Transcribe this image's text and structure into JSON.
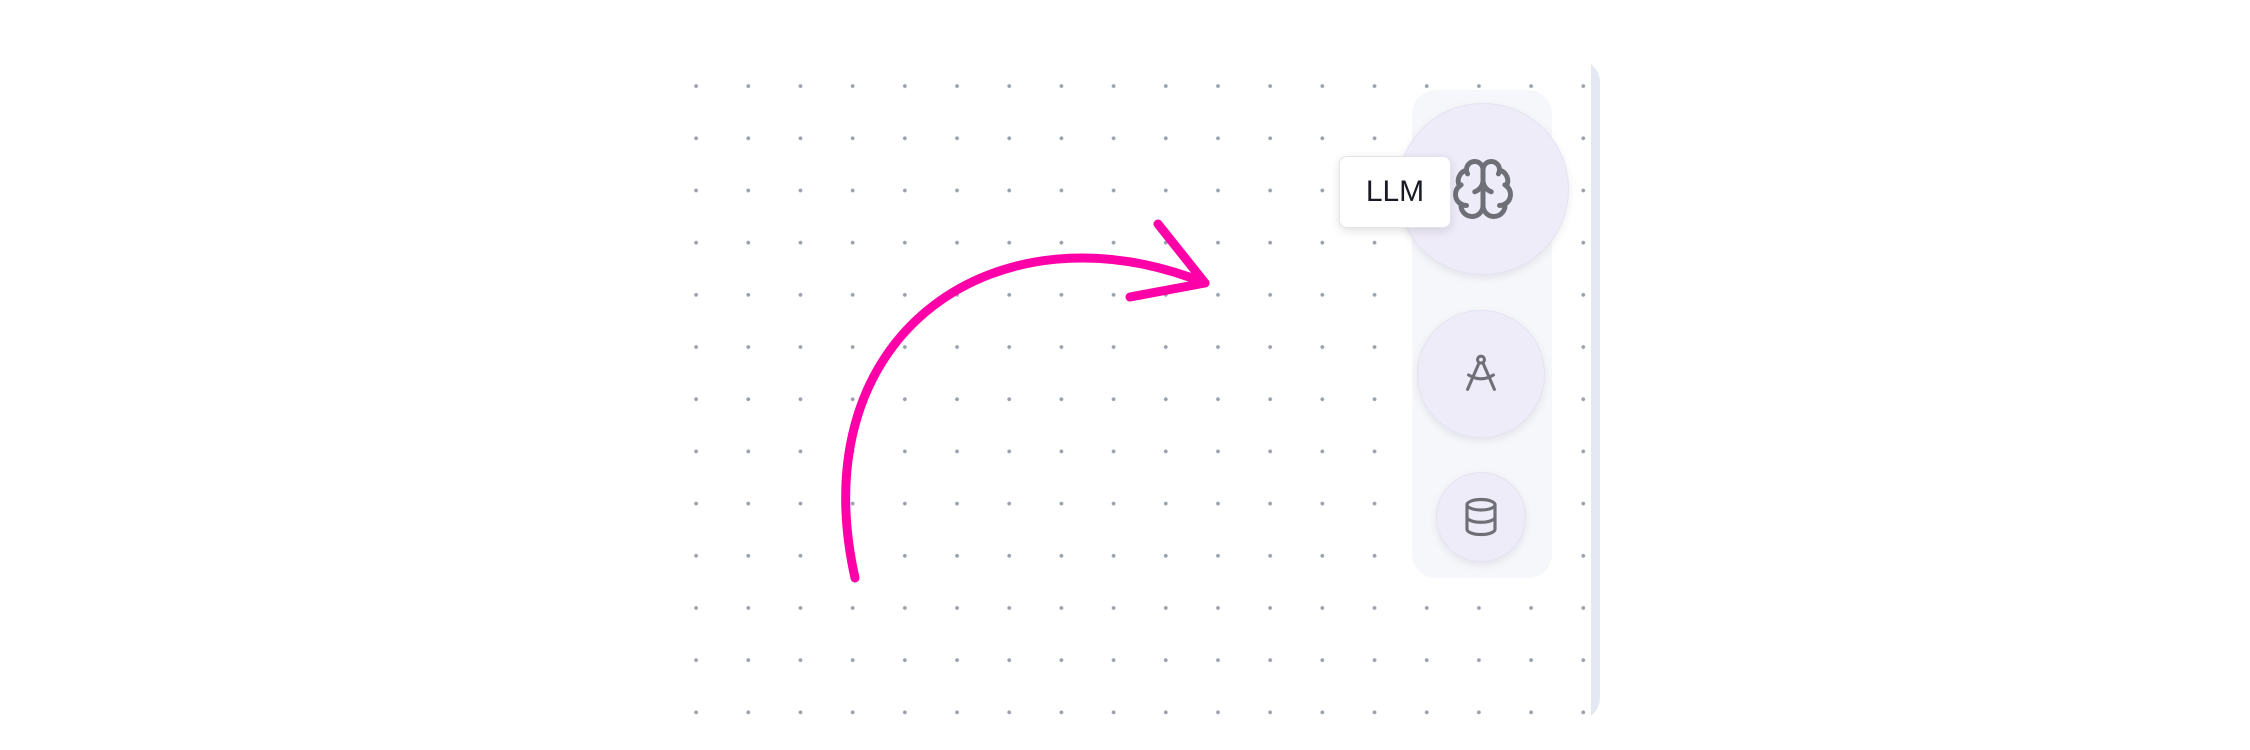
{
  "canvas": {
    "background": "#ffffff",
    "grid": "dotted",
    "dot_color": "#9aa1ab"
  },
  "annotation": {
    "type": "curved-arrow",
    "color": "#ff00a8"
  },
  "toolbar": {
    "tools": [
      {
        "name": "llm",
        "icon": "brain-icon",
        "tooltip": "LLM"
      },
      {
        "name": "compass",
        "icon": "compass-icon"
      },
      {
        "name": "database",
        "icon": "database-icon"
      }
    ],
    "button_fill": "#efecfa",
    "icon_color": "#6f6f78"
  }
}
